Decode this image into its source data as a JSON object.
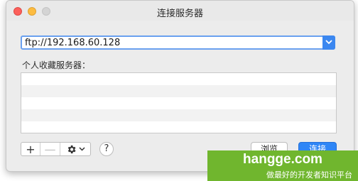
{
  "window": {
    "title": "连接服务器"
  },
  "server_address": {
    "value": "ftp://192.168.60.128"
  },
  "favorites": {
    "label": "个人收藏服务器：",
    "rows": 5
  },
  "toolbar": {
    "add_label": "+",
    "remove_label": "—",
    "help_label": "?",
    "browse_label": "浏览",
    "connect_label": "连接"
  },
  "watermark": {
    "site": "hangge.com",
    "slogan": "做最好的开发者知识平台"
  },
  "colors": {
    "accent": "#3b87f0",
    "connect_button": "#2f86f6",
    "watermark_bg": "#70b62e",
    "close": "#fc605b",
    "minimize": "#fdbc40"
  }
}
